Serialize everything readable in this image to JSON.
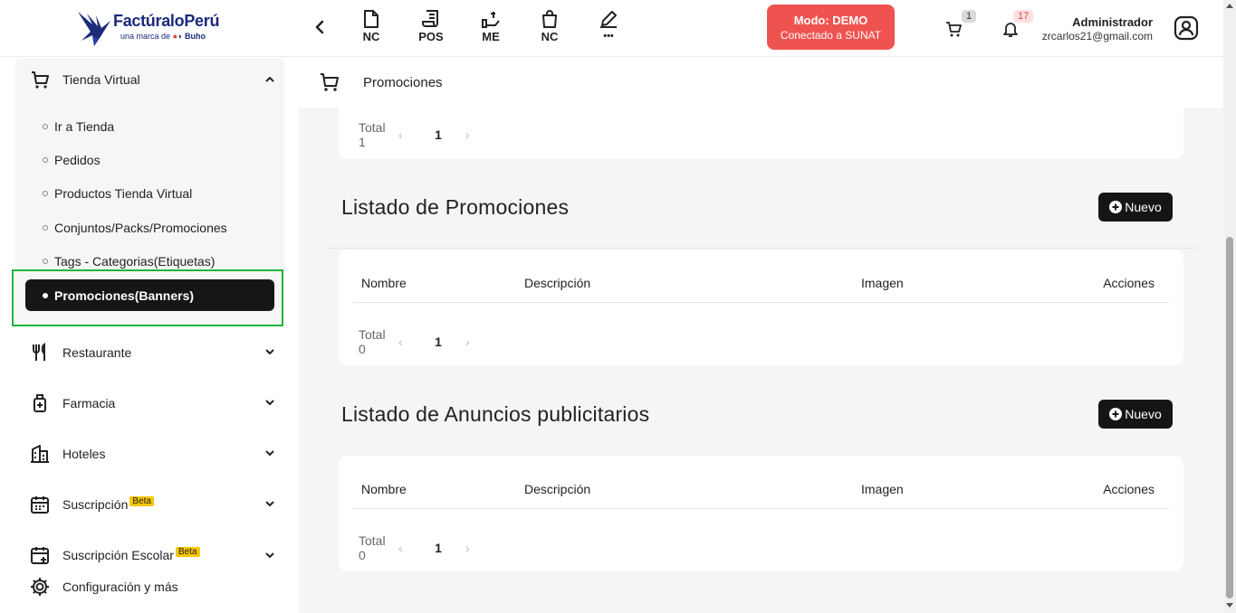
{
  "brand": {
    "name_part1": "Factúralo",
    "name_part2": "Perú",
    "sub_prefix": "una marca de",
    "sub_brand": "Buho"
  },
  "quick_actions": [
    {
      "label": "NC",
      "icon": "file-icon"
    },
    {
      "label": "POS",
      "icon": "receipt-icon"
    },
    {
      "label": "ME",
      "icon": "hand-money-icon"
    },
    {
      "label": "NC",
      "icon": "shopping-bag-icon"
    },
    {
      "label": "•••",
      "icon": "edit-icon"
    }
  ],
  "demo": {
    "line1": "Modo: DEMO",
    "line2": "Conectado a SUNAT",
    "color": "#ef5350"
  },
  "header": {
    "cart_badge": "1",
    "notif_badge": "17",
    "user_name": "Administrador",
    "user_email": "zrcarlos21@gmail.com"
  },
  "sidebar": {
    "tienda": {
      "label": "Tienda Virtual",
      "items": [
        "Ir a Tienda",
        "Pedidos",
        "Productos Tienda Virtual",
        "Conjuntos/Packs/Promociones",
        "Tags - Categorias(Etiquetas)"
      ],
      "active": "Promociones(Banners)"
    },
    "restaurante": "Restaurante",
    "farmacia": "Farmacia",
    "hoteles": "Hoteles",
    "suscripcion": "Suscripción",
    "suscripcion_escolar": "Suscripción Escolar",
    "beta": "Beta",
    "config": "Configuración y más"
  },
  "breadcrumb": {
    "label": "Promociones"
  },
  "top_card": {
    "total": "Total 1",
    "page": "1"
  },
  "promociones": {
    "title": "Listado de Promociones",
    "new_label": "Nuevo",
    "columns": [
      "Nombre",
      "Descripción",
      "Imagen",
      "Acciones"
    ],
    "total": "Total 0",
    "page": "1"
  },
  "anuncios": {
    "title": "Listado de Anuncios publicitarios",
    "new_label": "Nuevo",
    "columns": [
      "Nombre",
      "Descripción",
      "Imagen",
      "Acciones"
    ],
    "total": "Total 0",
    "page": "1"
  },
  "accent_color": "#151515",
  "highlight_color": "#22b33a"
}
